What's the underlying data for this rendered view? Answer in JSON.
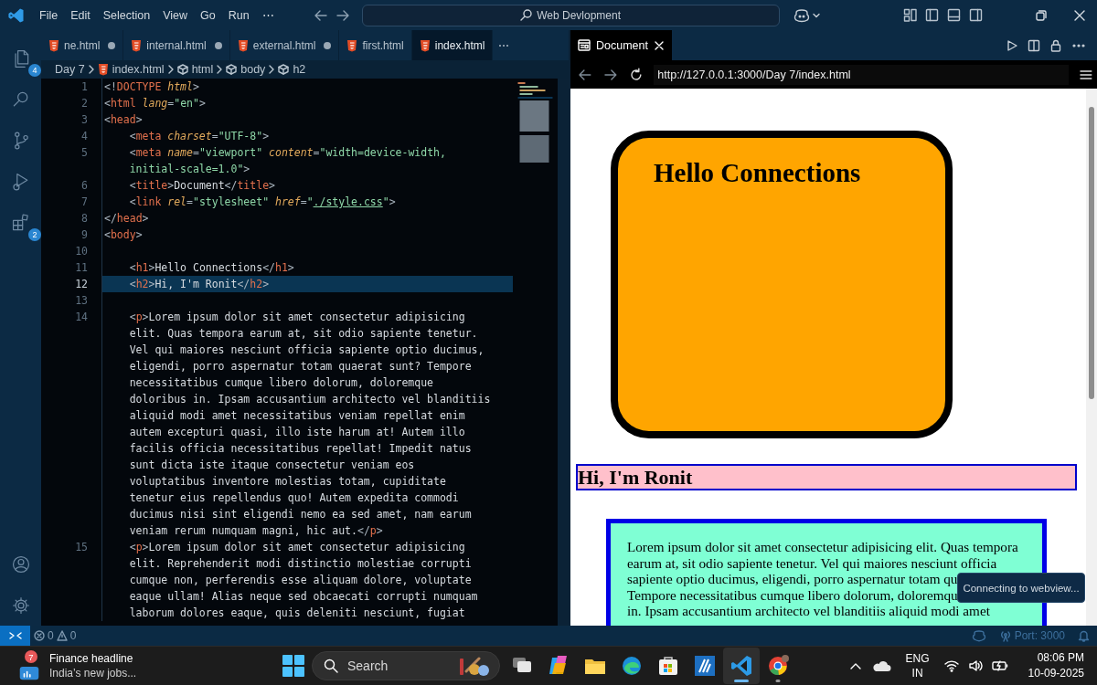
{
  "title_bar": {
    "menus": [
      "File",
      "Edit",
      "Selection",
      "View",
      "Go",
      "Run"
    ],
    "more": "⋯",
    "search": "Web Devlopment"
  },
  "activity_bar": {
    "items": [
      {
        "kind": "explorer",
        "badge": "4"
      },
      {
        "kind": "search"
      },
      {
        "kind": "source-control"
      },
      {
        "kind": "run-debug"
      },
      {
        "kind": "extensions",
        "badge": "2"
      }
    ]
  },
  "editor": {
    "tabs": [
      {
        "label": "ne.html",
        "modified": true,
        "selected": false
      },
      {
        "label": "internal.html",
        "modified": true,
        "selected": false
      },
      {
        "label": "external.html",
        "modified": true,
        "selected": false
      },
      {
        "label": "first.html",
        "modified": false,
        "selected": false
      },
      {
        "label": "index.html",
        "modified": false,
        "selected": true
      }
    ],
    "more": "⋯",
    "breadcrumb": [
      {
        "kind": "folder",
        "label": "Day 7"
      },
      {
        "kind": "file",
        "label": "index.html"
      },
      {
        "kind": "element",
        "label": "html"
      },
      {
        "kind": "element",
        "label": "body"
      },
      {
        "kind": "element",
        "label": "h2"
      }
    ],
    "lines": [
      {
        "number": "1",
        "current": false,
        "tokens": [
          {
            "kind": "punct",
            "text": "<!"
          },
          {
            "kind": "keyword",
            "text": "DOCTYPE "
          },
          {
            "kind": "attr",
            "text": "html"
          },
          {
            "kind": "punct",
            "text": ">"
          }
        ]
      },
      {
        "number": "2",
        "current": false,
        "tokens": [
          {
            "kind": "punct",
            "text": "<"
          },
          {
            "kind": "tag",
            "text": "html "
          },
          {
            "kind": "attr",
            "text": "lang"
          },
          {
            "kind": "punct",
            "text": "="
          },
          {
            "kind": "string",
            "text": "\"en\""
          },
          {
            "kind": "punct",
            "text": ">"
          }
        ]
      },
      {
        "number": "3",
        "current": false,
        "tokens": [
          {
            "kind": "punct",
            "text": "<"
          },
          {
            "kind": "tag",
            "text": "head"
          },
          {
            "kind": "punct",
            "text": ">"
          }
        ]
      },
      {
        "number": "4",
        "current": false,
        "tokens": [
          {
            "kind": "punct",
            "text": "    <"
          },
          {
            "kind": "tag",
            "text": "meta "
          },
          {
            "kind": "attr",
            "text": "charset"
          },
          {
            "kind": "punct",
            "text": "="
          },
          {
            "kind": "string",
            "text": "\"UTF-8\""
          },
          {
            "kind": "punct",
            "text": ">"
          }
        ]
      },
      {
        "number": "5",
        "current": false,
        "tokens": [
          {
            "kind": "punct",
            "text": "    <"
          },
          {
            "kind": "tag",
            "text": "meta "
          },
          {
            "kind": "attr",
            "text": "name"
          },
          {
            "kind": "punct",
            "text": "="
          },
          {
            "kind": "string",
            "text": "\"viewport\" "
          },
          {
            "kind": "attr",
            "text": "content"
          },
          {
            "kind": "punct",
            "text": "="
          },
          {
            "kind": "string",
            "text": "\"width=device-width,"
          }
        ]
      },
      {
        "current": false,
        "tokens": [
          {
            "kind": "string",
            "text": "    initial-scale=1.0\""
          },
          {
            "kind": "punct",
            "text": ">"
          }
        ]
      },
      {
        "number": "6",
        "current": false,
        "tokens": [
          {
            "kind": "punct",
            "text": "    <"
          },
          {
            "kind": "tag",
            "text": "title"
          },
          {
            "kind": "punct",
            "text": ">"
          },
          {
            "kind": "text",
            "text": "Document"
          },
          {
            "kind": "punct",
            "text": "</"
          },
          {
            "kind": "tag",
            "text": "title"
          },
          {
            "kind": "punct",
            "text": ">"
          }
        ]
      },
      {
        "number": "7",
        "current": false,
        "tokens": [
          {
            "kind": "punct",
            "text": "    <"
          },
          {
            "kind": "tag",
            "text": "link "
          },
          {
            "kind": "attr",
            "text": "rel"
          },
          {
            "kind": "punct",
            "text": "="
          },
          {
            "kind": "string",
            "text": "\"stylesheet\" "
          },
          {
            "kind": "attr",
            "text": "href"
          },
          {
            "kind": "punct",
            "text": "="
          },
          {
            "kind": "string",
            "text": "\""
          },
          {
            "kind": "link",
            "text": "./style.css"
          },
          {
            "kind": "string",
            "text": "\""
          },
          {
            "kind": "punct",
            "text": ">"
          }
        ]
      },
      {
        "number": "8",
        "current": false,
        "tokens": [
          {
            "kind": "punct",
            "text": "</"
          },
          {
            "kind": "tag",
            "text": "head"
          },
          {
            "kind": "punct",
            "text": ">"
          }
        ]
      },
      {
        "number": "9",
        "current": false,
        "tokens": [
          {
            "kind": "punct",
            "text": "<"
          },
          {
            "kind": "tag",
            "text": "body"
          },
          {
            "kind": "punct",
            "text": ">"
          }
        ]
      },
      {
        "number": "10",
        "current": false
      },
      {
        "number": "11",
        "current": false,
        "tokens": [
          {
            "kind": "punct",
            "text": "    <"
          },
          {
            "kind": "tag",
            "text": "h1"
          },
          {
            "kind": "punct",
            "text": ">"
          },
          {
            "kind": "text",
            "text": "Hello Connections"
          },
          {
            "kind": "punct",
            "text": "</"
          },
          {
            "kind": "tag",
            "text": "h1"
          },
          {
            "kind": "punct",
            "text": ">"
          }
        ]
      },
      {
        "number": "12",
        "current": true,
        "tokens": [
          {
            "kind": "punct",
            "text": "    <"
          },
          {
            "kind": "tag",
            "text": "h2"
          },
          {
            "kind": "punct",
            "text": ">"
          },
          {
            "kind": "text",
            "text": "Hi, I'm Ronit"
          },
          {
            "kind": "punct",
            "text": "</"
          },
          {
            "kind": "tag",
            "text": "h2"
          },
          {
            "kind": "punct",
            "text": ">"
          }
        ]
      },
      {
        "number": "13",
        "current": false
      },
      {
        "number": "14",
        "current": false,
        "tokens": [
          {
            "kind": "punct",
            "text": "    <"
          },
          {
            "kind": "tag",
            "text": "p"
          },
          {
            "kind": "punct",
            "text": ">"
          },
          {
            "kind": "text",
            "text": "Lorem ipsum dolor sit amet consectetur adipisicing"
          }
        ]
      },
      {
        "current": false,
        "tokens": [
          {
            "kind": "text",
            "text": "    elit. Quas tempora earum at, sit odio sapiente tenetur."
          }
        ]
      },
      {
        "current": false,
        "tokens": [
          {
            "kind": "text",
            "text": "    Vel qui maiores nesciunt officia sapiente optio ducimus,"
          }
        ]
      },
      {
        "current": false,
        "tokens": [
          {
            "kind": "text",
            "text": "    eligendi, porro aspernatur totam quaerat sunt? Tempore"
          }
        ]
      },
      {
        "current": false,
        "tokens": [
          {
            "kind": "text",
            "text": "    necessitatibus cumque libero dolorum, doloremque"
          }
        ]
      },
      {
        "current": false,
        "tokens": [
          {
            "kind": "text",
            "text": "    doloribus in. Ipsam accusantium architecto vel blanditiis"
          }
        ]
      },
      {
        "current": false,
        "tokens": [
          {
            "kind": "text",
            "text": "    aliquid modi amet necessitatibus veniam repellat enim"
          }
        ]
      },
      {
        "current": false,
        "tokens": [
          {
            "kind": "text",
            "text": "    autem excepturi quasi, illo iste harum at! Autem illo"
          }
        ]
      },
      {
        "current": false,
        "tokens": [
          {
            "kind": "text",
            "text": "    facilis officia necessitatibus repellat! Impedit natus"
          }
        ]
      },
      {
        "current": false,
        "tokens": [
          {
            "kind": "text",
            "text": "    sunt dicta iste itaque consectetur veniam eos"
          }
        ]
      },
      {
        "current": false,
        "tokens": [
          {
            "kind": "text",
            "text": "    voluptatibus inventore molestias totam, cupiditate"
          }
        ]
      },
      {
        "current": false,
        "tokens": [
          {
            "kind": "text",
            "text": "    tenetur eius repellendus quo! Autem expedita commodi"
          }
        ]
      },
      {
        "current": false,
        "tokens": [
          {
            "kind": "text",
            "text": "    ducimus nisi sint eligendi nemo ea sed amet, nam earum"
          }
        ]
      },
      {
        "current": false,
        "tokens": [
          {
            "kind": "text",
            "text": "    veniam rerum numquam magni, hic aut."
          },
          {
            "kind": "punct",
            "text": "</"
          },
          {
            "kind": "tag",
            "text": "p"
          },
          {
            "kind": "punct",
            "text": ">"
          }
        ]
      },
      {
        "number": "15",
        "current": false,
        "tokens": [
          {
            "kind": "punct",
            "text": "    <"
          },
          {
            "kind": "tag",
            "text": "p"
          },
          {
            "kind": "punct",
            "text": ">"
          },
          {
            "kind": "text",
            "text": "Lorem ipsum dolor sit amet consectetur adipisicing"
          }
        ]
      },
      {
        "current": false,
        "tokens": [
          {
            "kind": "text",
            "text": "    elit. Reprehenderit modi distinctio molestiae corrupti"
          }
        ]
      },
      {
        "current": false,
        "tokens": [
          {
            "kind": "text",
            "text": "    cumque non, perferendis esse aliquam dolore, voluptate"
          }
        ]
      },
      {
        "current": false,
        "tokens": [
          {
            "kind": "text",
            "text": "    eaque ullam! Alias neque sed obcaecati corrupti numquam"
          }
        ]
      },
      {
        "current": false,
        "tokens": [
          {
            "kind": "text",
            "text": "    laborum dolores eaque, quis deleniti nesciunt, fugiat"
          }
        ]
      }
    ]
  },
  "preview": {
    "tab": "Document",
    "url": "http://127.0.0.1:3000/Day 7/index.html",
    "heading": "Hello Connections",
    "subheading": "Hi, I'm Ronit",
    "paragraph_lines": [
      "Lorem ipsum dolor sit amet consectetur adipisicing elit. Quas tempora",
      "earum at, sit odio sapiente tenetur. Vel qui maiores nesciunt officia",
      "sapiente optio ducimus, eligendi, porro aspernatur totam qu",
      "Tempore necessitatibus cumque libero dolorum, doloremqu",
      "in. Ipsam accusantium architecto vel blanditiis aliquid modi amet"
    ],
    "toast": "Connecting to webview..."
  },
  "status_bar": {
    "errors": "0",
    "warnings": "0",
    "port": "Port: 3000"
  },
  "taskbar": {
    "widget": {
      "badge": "7",
      "title": "Finance headline",
      "subtitle": "India’s new jobs..."
    },
    "search": {
      "placeholder": "Search"
    },
    "apps": [
      {
        "kind": "task-view",
        "active": false,
        "running": false
      },
      {
        "kind": "copilot",
        "active": false,
        "running": false
      },
      {
        "kind": "files",
        "active": false,
        "running": false
      },
      {
        "kind": "edge",
        "active": false,
        "running": false
      },
      {
        "kind": "store",
        "active": false,
        "running": false
      },
      {
        "kind": "app",
        "active": false,
        "running": false
      },
      {
        "kind": "code",
        "active": true,
        "running": true
      },
      {
        "kind": "chrome",
        "active": false,
        "running": true
      }
    ],
    "tray": {
      "language": "ENG",
      "region": "IN",
      "time": "08:06 PM",
      "date": "10-09-2025"
    }
  }
}
